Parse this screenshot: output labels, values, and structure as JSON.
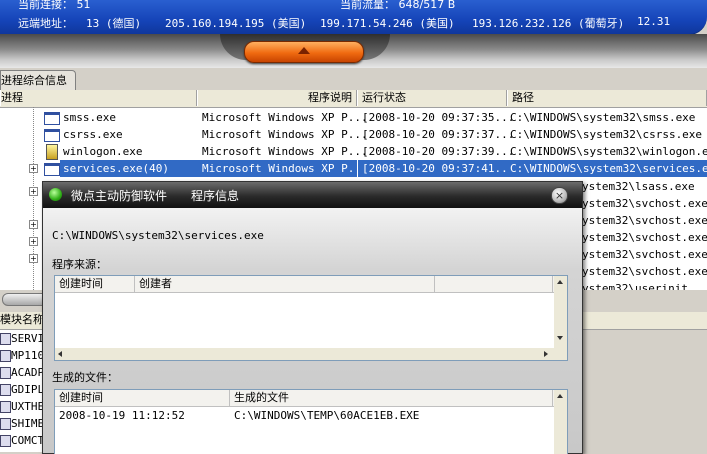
{
  "top": {
    "row1_left": "当前连接： 51",
    "row1_right": "当前流量： 648/517 B",
    "row2_label": "远端地址：",
    "row2_values": [
      "13 (德国)",
      "205.160.194.195 (美国)",
      "199.171.54.246 (美国)",
      "193.126.232.126 (葡萄牙)",
      "12.31"
    ]
  },
  "tab": {
    "label": "进程综合信息"
  },
  "grid": {
    "headers": [
      "进程",
      "程序说明",
      "运行状态",
      "路径"
    ],
    "rows": [
      {
        "name": "smss.exe",
        "desc": "Microsoft Windows XP P...",
        "status": "[2008-10-20 09:37:35...",
        "path": "C:\\WINDOWS\\system32\\smss.exe",
        "expand": false,
        "selected": false
      },
      {
        "name": "csrss.exe",
        "desc": "Microsoft Windows XP P...",
        "status": "[2008-10-20 09:37:37...",
        "path": "C:\\WINDOWS\\system32\\csrss.exe",
        "expand": false,
        "selected": false
      },
      {
        "name": "winlogon.exe",
        "desc": "Microsoft Windows XP P...",
        "status": "[2008-10-20 09:37:39...",
        "path": "C:\\WINDOWS\\system32\\winlogon.exe",
        "expand": false,
        "selected": false
      },
      {
        "name": "services.exe(40)",
        "desc": "Microsoft Windows XP P...",
        "status": "[2008-10-20 09:37:41...",
        "path": "C:\\WINDOWS\\system32\\services.exe",
        "expand": true,
        "selected": true
      }
    ],
    "hidden_paths": [
      "ystem32\\lsass.exe",
      "ystem32\\svchost.exe",
      "ystem32\\svchost.exe",
      "ystem32\\svchost.exe",
      "ystem32\\svchost.exe",
      "ystem32\\svchost.exe",
      "ystem32\\userinit"
    ]
  },
  "modules": {
    "header": "模块名称",
    "items": [
      "SERVI",
      "MP110",
      "ACADP",
      "GDIPL",
      "UXTHE",
      "SHIME",
      "COMCT"
    ]
  },
  "popup": {
    "title": "微点主动防御软件",
    "subtitle": "程序信息",
    "path": "C:\\WINDOWS\\system32\\services.exe",
    "source_label": "程序来源：",
    "source_headers": [
      "创建时间",
      "创建者"
    ],
    "files_label": "生成的文件：",
    "files_headers": [
      "创建时间",
      "生成的文件"
    ],
    "files_rows": [
      {
        "time": "2008-10-19 11:12:52",
        "file": "C:\\WINDOWS\\TEMP\\60ACE1EB.EXE"
      }
    ]
  },
  "colors": {
    "selection": "#316ac5",
    "top_band": "#1544b8",
    "toggle": "#f06a10"
  }
}
